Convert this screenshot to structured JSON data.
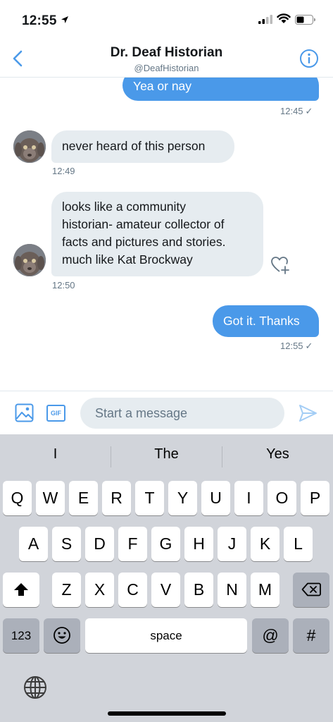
{
  "status_bar": {
    "time": "12:55"
  },
  "header": {
    "title": "Dr. Deaf Historian",
    "handle": "@DeafHistorian"
  },
  "messages": [
    {
      "direction": "out",
      "text": "Yea or nay",
      "time": "12:45",
      "read": true
    },
    {
      "direction": "in",
      "text": "never heard of this person",
      "time": "12:49"
    },
    {
      "direction": "in",
      "lines": [
        "looks like a community",
        "historian- amateur collector of",
        "facts and pictures and stories.",
        "much like Kat Brockway"
      ],
      "time": "12:50"
    },
    {
      "direction": "out",
      "text": "Got it. Thanks",
      "time": "12:55",
      "read": true
    }
  ],
  "compose": {
    "placeholder": "Start a message",
    "gif_label": "GIF"
  },
  "keyboard": {
    "suggestions": [
      "I",
      "The",
      "Yes"
    ],
    "row1": [
      "Q",
      "W",
      "E",
      "R",
      "T",
      "Y",
      "U",
      "I",
      "O",
      "P"
    ],
    "row2": [
      "A",
      "S",
      "D",
      "F",
      "G",
      "H",
      "J",
      "K",
      "L"
    ],
    "row3": [
      "Z",
      "X",
      "C",
      "V",
      "B",
      "N",
      "M"
    ],
    "numbers_label": "123",
    "space_label": "space",
    "at_label": "@",
    "hash_label": "#"
  },
  "colors": {
    "accent": "#4a99e9",
    "incoming_bubble": "#e6ecf0",
    "keyboard_bg": "#d1d4da"
  },
  "icons": [
    "location-arrow-icon",
    "signal-icon",
    "wifi-icon",
    "battery-icon",
    "back-chevron-icon",
    "info-icon",
    "like-plus-icon",
    "image-icon",
    "gif-icon",
    "send-icon",
    "shift-icon",
    "backspace-icon",
    "emoji-icon",
    "globe-icon"
  ]
}
